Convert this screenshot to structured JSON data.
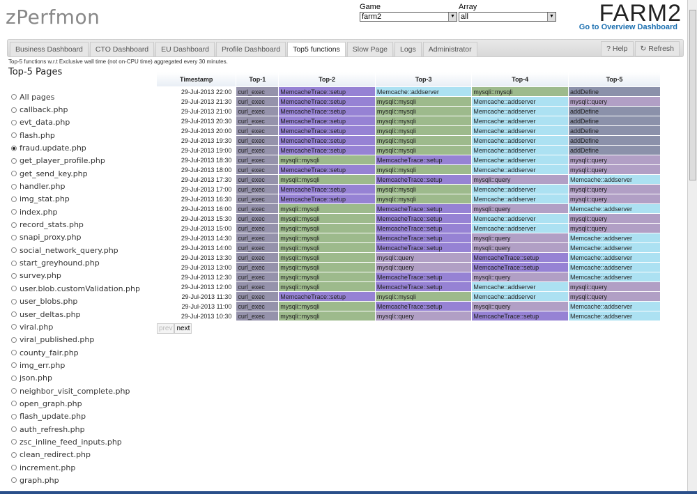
{
  "app_title": "zPerfmon",
  "game": {
    "label": "Game",
    "value": "farm2"
  },
  "array": {
    "label": "Array",
    "value": "all"
  },
  "brand": "FARM2",
  "overview_link": "Go to Overview Dashboard",
  "tabs": [
    "Business Dashboard",
    "CTO Dashboard",
    "EU Dashboard",
    "Profile Dashboard",
    "Top5 functions",
    "Slow Page",
    "Logs",
    "Administrator"
  ],
  "active_tab": 4,
  "help_label": "? Help",
  "refresh_label": "↻ Refresh",
  "description": "Top-5 functions w.r.t Exclusive wall time (not on-CPU time) aggregated every 30 minutes.",
  "sidebar": {
    "title": "Top-5 Pages",
    "selected": 4,
    "pages": [
      "All pages",
      "callback.php",
      "evt_data.php",
      "flash.php",
      "fraud.update.php",
      "get_player_profile.php",
      "get_send_key.php",
      "handler.php",
      "img_stat.php",
      "index.php",
      "record_stats.php",
      "snapi_proxy.php",
      "social_network_query.php",
      "start_greyhound.php",
      "survey.php",
      "user.blob.customValidation.php",
      "user_blobs.php",
      "user_deltas.php",
      "viral.php",
      "viral_published.php",
      "county_fair.php",
      "img_err.php",
      "json.php",
      "neighbor_visit_complete.php",
      "open_graph.php",
      "flash_update.php",
      "auth_refresh.php",
      "zsc_inline_feed_inputs.php",
      "clean_redirect.php",
      "increment.php",
      "graph.php"
    ]
  },
  "table": {
    "headers": [
      "Timestamp",
      "Top-1",
      "Top-2",
      "Top-3",
      "Top-4",
      "Top-5"
    ],
    "function_colors": {
      "curl_exec": "#9592ab",
      "MemcacheTrace::setup": "#9682d4",
      "Memcache::addserver": "#ace1f2",
      "mysqli::mysqli": "#9dba8c",
      "mysqli::query": "#b19fc5",
      "addDefine": "#8b91aa"
    },
    "rows": [
      [
        "29-Jul-2013 22:00",
        "curl_exec",
        "MemcacheTrace::setup",
        "Memcache::addserver",
        "mysqli::mysqli",
        "addDefine"
      ],
      [
        "29-Jul-2013 21:30",
        "curl_exec",
        "MemcacheTrace::setup",
        "mysqli::mysqli",
        "Memcache::addserver",
        "mysqli::query"
      ],
      [
        "29-Jul-2013 21:00",
        "curl_exec",
        "MemcacheTrace::setup",
        "mysqli::mysqli",
        "Memcache::addserver",
        "addDefine"
      ],
      [
        "29-Jul-2013 20:30",
        "curl_exec",
        "MemcacheTrace::setup",
        "mysqli::mysqli",
        "Memcache::addserver",
        "addDefine"
      ],
      [
        "29-Jul-2013 20:00",
        "curl_exec",
        "MemcacheTrace::setup",
        "mysqli::mysqli",
        "Memcache::addserver",
        "addDefine"
      ],
      [
        "29-Jul-2013 19:30",
        "curl_exec",
        "MemcacheTrace::setup",
        "mysqli::mysqli",
        "Memcache::addserver",
        "addDefine"
      ],
      [
        "29-Jul-2013 19:00",
        "curl_exec",
        "MemcacheTrace::setup",
        "mysqli::mysqli",
        "Memcache::addserver",
        "addDefine"
      ],
      [
        "29-Jul-2013 18:30",
        "curl_exec",
        "mysqli::mysqli",
        "MemcacheTrace::setup",
        "Memcache::addserver",
        "mysqli::query"
      ],
      [
        "29-Jul-2013 18:00",
        "curl_exec",
        "MemcacheTrace::setup",
        "mysqli::mysqli",
        "Memcache::addserver",
        "mysqli::query"
      ],
      [
        "29-Jul-2013 17:30",
        "curl_exec",
        "mysqli::mysqli",
        "MemcacheTrace::setup",
        "mysqli::query",
        "Memcache::addserver"
      ],
      [
        "29-Jul-2013 17:00",
        "curl_exec",
        "MemcacheTrace::setup",
        "mysqli::mysqli",
        "Memcache::addserver",
        "mysqli::query"
      ],
      [
        "29-Jul-2013 16:30",
        "curl_exec",
        "MemcacheTrace::setup",
        "mysqli::mysqli",
        "Memcache::addserver",
        "mysqli::query"
      ],
      [
        "29-Jul-2013 16:00",
        "curl_exec",
        "mysqli::mysqli",
        "MemcacheTrace::setup",
        "mysqli::query",
        "Memcache::addserver"
      ],
      [
        "29-Jul-2013 15:30",
        "curl_exec",
        "mysqli::mysqli",
        "MemcacheTrace::setup",
        "Memcache::addserver",
        "mysqli::query"
      ],
      [
        "29-Jul-2013 15:00",
        "curl_exec",
        "mysqli::mysqli",
        "MemcacheTrace::setup",
        "Memcache::addserver",
        "mysqli::query"
      ],
      [
        "29-Jul-2013 14:30",
        "curl_exec",
        "mysqli::mysqli",
        "MemcacheTrace::setup",
        "mysqli::query",
        "Memcache::addserver"
      ],
      [
        "29-Jul-2013 14:00",
        "curl_exec",
        "mysqli::mysqli",
        "MemcacheTrace::setup",
        "mysqli::query",
        "Memcache::addserver"
      ],
      [
        "29-Jul-2013 13:30",
        "curl_exec",
        "mysqli::mysqli",
        "mysqli::query",
        "MemcacheTrace::setup",
        "Memcache::addserver"
      ],
      [
        "29-Jul-2013 13:00",
        "curl_exec",
        "mysqli::mysqli",
        "mysqli::query",
        "MemcacheTrace::setup",
        "Memcache::addserver"
      ],
      [
        "29-Jul-2013 12:30",
        "curl_exec",
        "mysqli::mysqli",
        "MemcacheTrace::setup",
        "mysqli::query",
        "Memcache::addserver"
      ],
      [
        "29-Jul-2013 12:00",
        "curl_exec",
        "mysqli::mysqli",
        "MemcacheTrace::setup",
        "Memcache::addserver",
        "mysqli::query"
      ],
      [
        "29-Jul-2013 11:30",
        "curl_exec",
        "MemcacheTrace::setup",
        "mysqli::mysqli",
        "Memcache::addserver",
        "mysqli::query"
      ],
      [
        "29-Jul-2013 11:00",
        "curl_exec",
        "mysqli::mysqli",
        "MemcacheTrace::setup",
        "mysqli::query",
        "Memcache::addserver"
      ],
      [
        "29-Jul-2013 10:30",
        "curl_exec",
        "mysqli::mysqli",
        "mysqli::query",
        "MemcacheTrace::setup",
        "Memcache::addserver"
      ]
    ]
  },
  "pager": {
    "prev": "prev",
    "next": "next"
  }
}
